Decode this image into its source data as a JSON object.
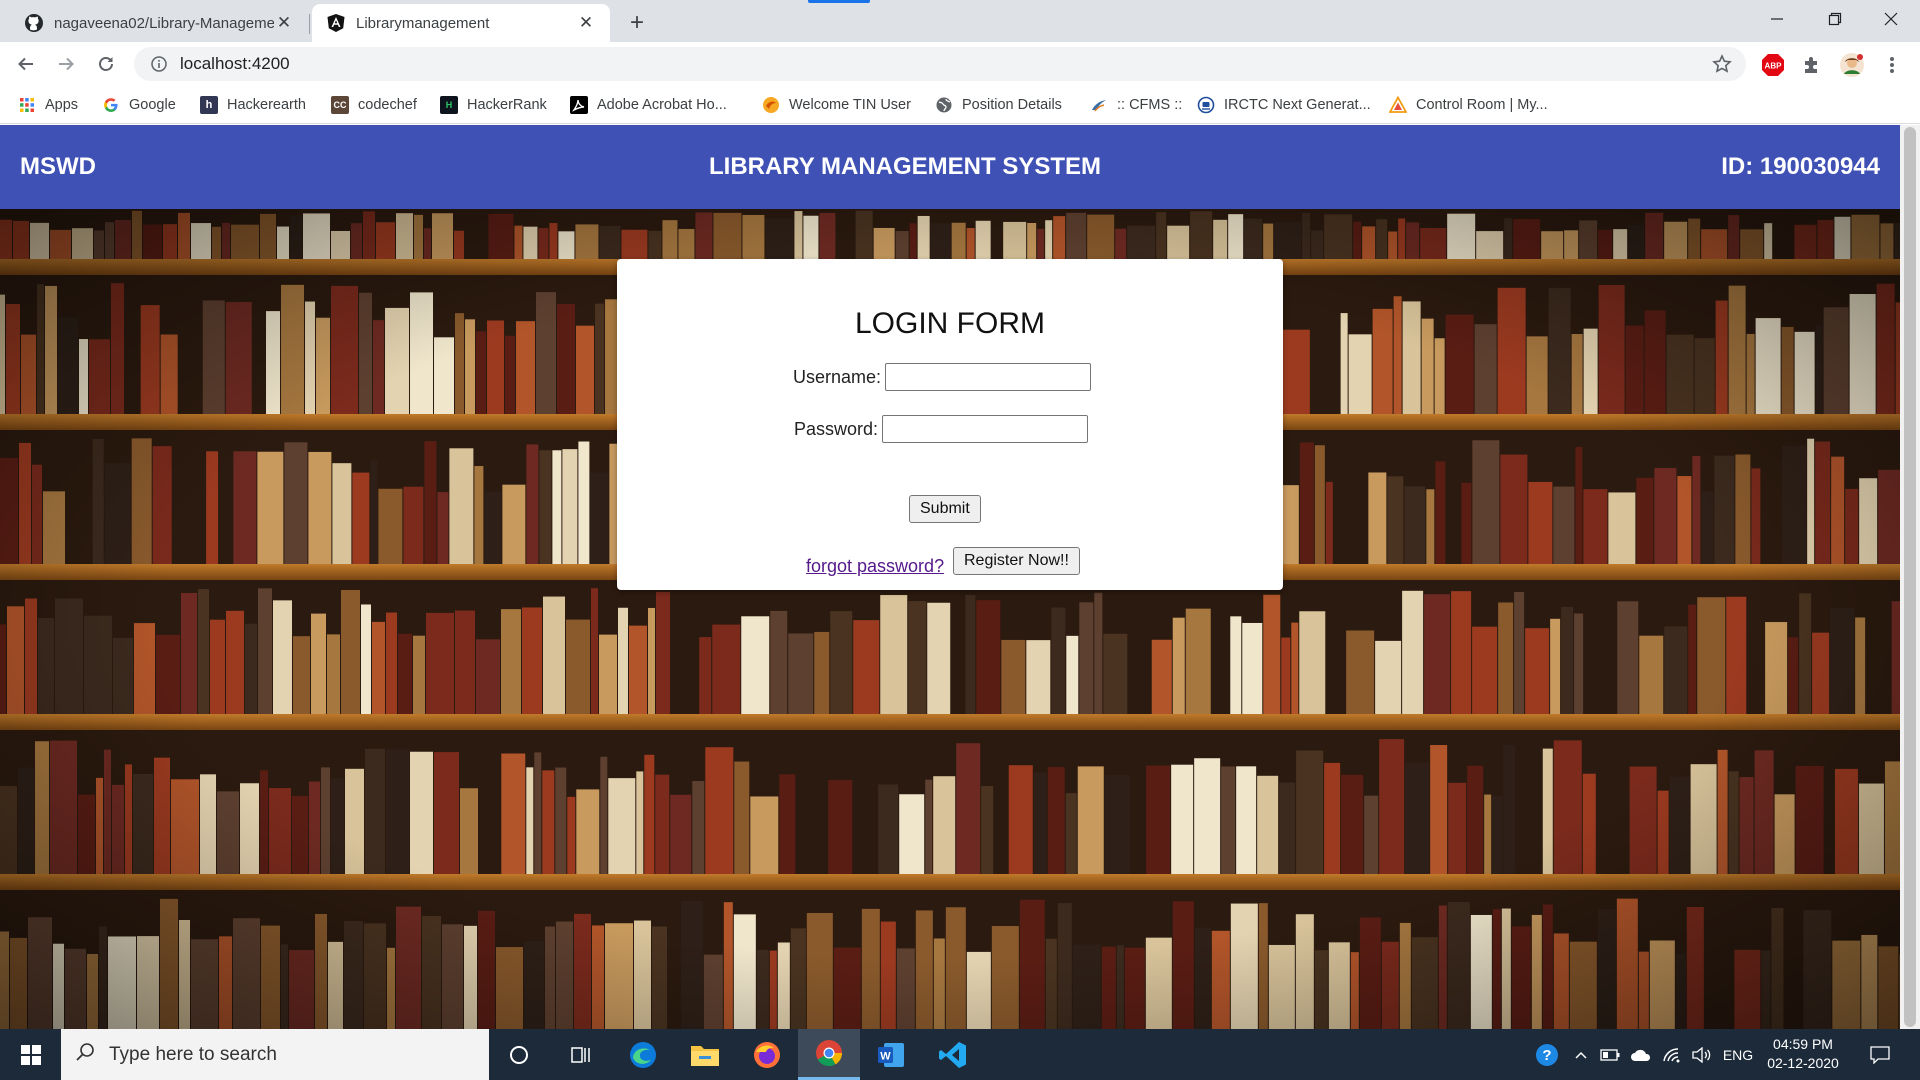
{
  "browser": {
    "tabs": [
      {
        "title": "nagaveena02/Library-Manageme",
        "icon": "github-icon"
      },
      {
        "title": "Librarymanagement",
        "icon": "angular-icon"
      }
    ],
    "address": "localhost:4200",
    "bookmarks": [
      {
        "label": "Apps",
        "icon": "apps-grid-icon"
      },
      {
        "label": "Google",
        "icon": "google-icon"
      },
      {
        "label": "Hackerearth",
        "icon": "hackerearth-icon"
      },
      {
        "label": "codechef",
        "icon": "codechef-icon"
      },
      {
        "label": "HackerRank",
        "icon": "hackerrank-icon"
      },
      {
        "label": "Adobe Acrobat Ho...",
        "icon": "adobe-acrobat-icon"
      },
      {
        "label": "Welcome TIN User",
        "icon": "tin-icon"
      },
      {
        "label": "Position Details",
        "icon": "globe-icon"
      },
      {
        "label": ":: CFMS ::",
        "icon": "cfms-icon"
      },
      {
        "label": "IRCTC Next Generat...",
        "icon": "irctc-icon"
      },
      {
        "label": "Control Room | My...",
        "icon": "control-room-icon"
      }
    ]
  },
  "app": {
    "brand": "MSWD",
    "title": "LIBRARY MANAGEMENT SYSTEM",
    "id_label": "ID: 190030944",
    "header_color": "#3f51b5"
  },
  "login": {
    "title": "LOGIN FORM",
    "username_label": "Username:",
    "username_value": "",
    "password_label": "Password:",
    "password_value": "",
    "submit_label": "Submit",
    "forgot_label": "forgot password?",
    "register_label": "Register Now!!"
  },
  "taskbar": {
    "search_placeholder": "Type here to search",
    "language": "ENG",
    "time": "04:59 PM",
    "date": "02-12-2020"
  }
}
